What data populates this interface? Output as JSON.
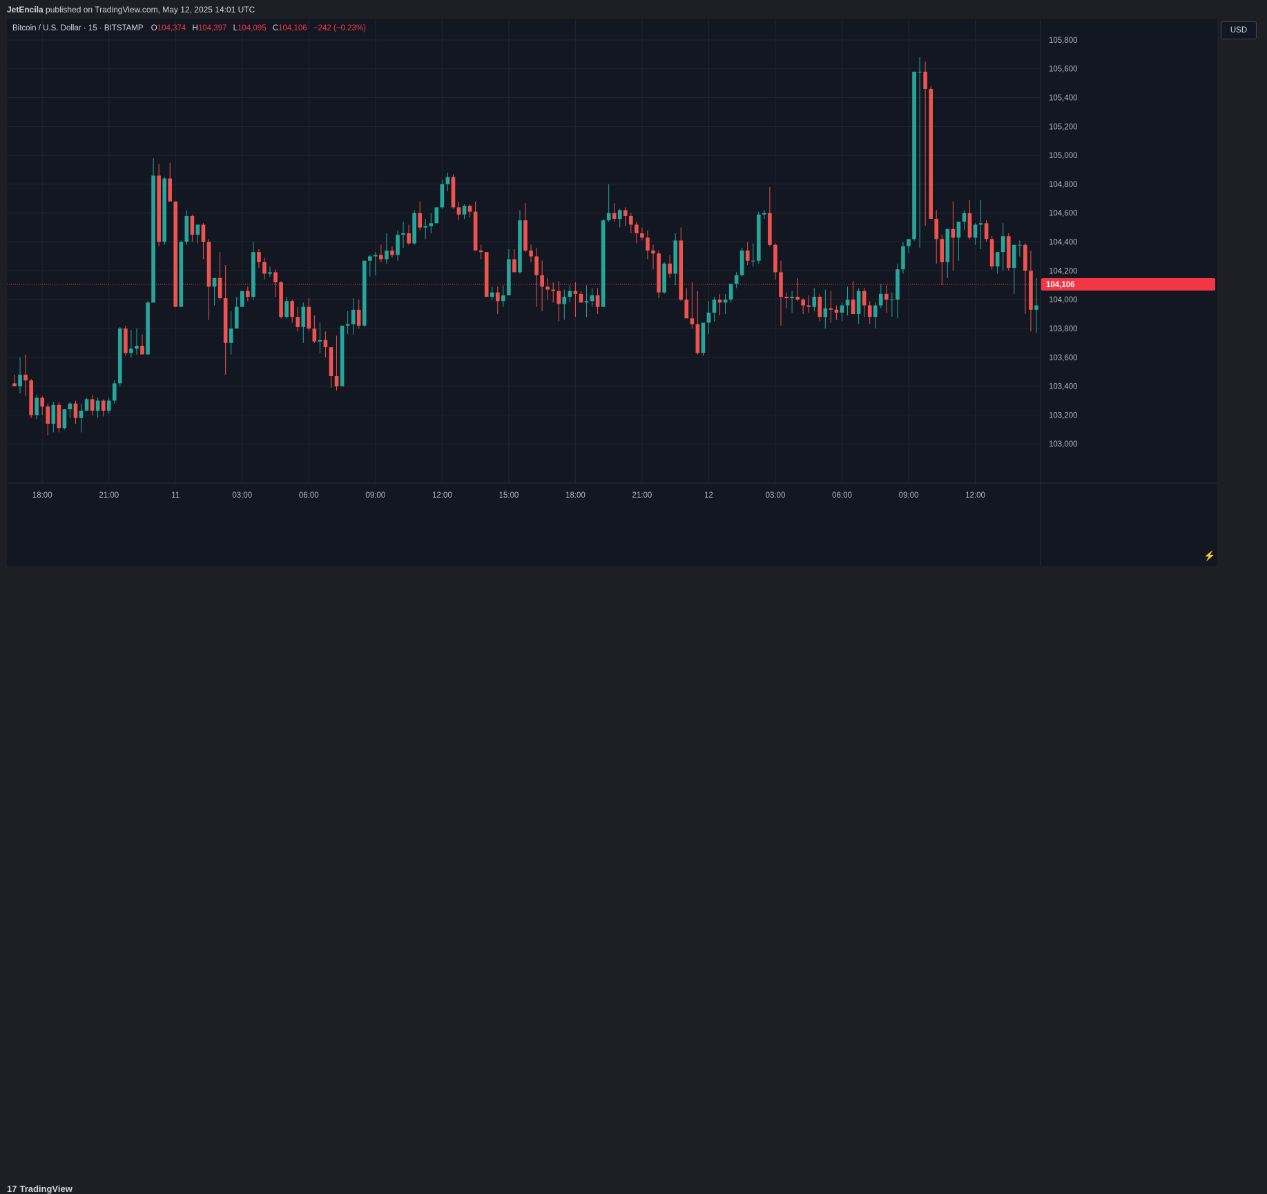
{
  "header": {
    "author": "JetEncila",
    "published_text": "published on TradingView.com, May 12, 2025 14:01 UTC"
  },
  "legend": {
    "symbol": "Bitcoin / U.S. Dollar · 15 · BITSTAMP",
    "o_key": "O",
    "o_val": "104,374",
    "h_key": "H",
    "h_val": "104,397",
    "l_key": "L",
    "l_val": "104,095",
    "c_key": "C",
    "c_val": "104,106",
    "change": "−242 (−0.23%)"
  },
  "currency_button": "USD",
  "footer": {
    "logo_mark": "17",
    "logo_text": "TradingView"
  },
  "colors": {
    "up": "#26a69a",
    "down": "#ef5350",
    "background": "#131722",
    "grid": "#1f2532",
    "price_tag": "#f23645"
  },
  "chart_data": {
    "type": "candlestick",
    "symbol": "BTCUSD",
    "exchange": "BITSTAMP",
    "interval": "15",
    "ylim": [
      102800,
      105900
    ],
    "y_ticks": [
      103000,
      103200,
      103400,
      103600,
      103800,
      104000,
      104200,
      104400,
      104600,
      104800,
      105000,
      105200,
      105400,
      105600,
      105800
    ],
    "y_tick_labels": [
      "103,000",
      "103,200",
      "103,400",
      "103,600",
      "103,800",
      "104,000",
      "104,200",
      "104,400",
      "104,600",
      "104,800",
      "105,000",
      "105,200",
      "105,400",
      "105,600",
      "105,800"
    ],
    "x_ticks": [
      {
        "label": "18:00",
        "bar": 5
      },
      {
        "label": "21:00",
        "bar": 17
      },
      {
        "label": "11",
        "bar": 29
      },
      {
        "label": "03:00",
        "bar": 41
      },
      {
        "label": "06:00",
        "bar": 53
      },
      {
        "label": "09:00",
        "bar": 65
      },
      {
        "label": "12:00",
        "bar": 77
      },
      {
        "label": "15:00",
        "bar": 89
      },
      {
        "label": "18:00",
        "bar": 101
      },
      {
        "label": "21:00",
        "bar": 113
      },
      {
        "label": "12",
        "bar": 125
      },
      {
        "label": "03:00",
        "bar": 137
      },
      {
        "label": "06:00",
        "bar": 149
      },
      {
        "label": "09:00",
        "bar": 161
      },
      {
        "label": "12:00",
        "bar": 173
      }
    ],
    "last_price": 104106,
    "last_price_label": "104,106",
    "grid": true,
    "candles": [
      [
        103420,
        103480,
        103400,
        103400
      ],
      [
        103400,
        103600,
        103350,
        103480
      ],
      [
        103480,
        103620,
        103330,
        103440
      ],
      [
        103440,
        103450,
        103180,
        103200
      ],
      [
        103200,
        103340,
        103170,
        103320
      ],
      [
        103320,
        103330,
        103200,
        103260
      ],
      [
        103260,
        103280,
        103060,
        103140
      ],
      [
        103140,
        103290,
        103080,
        103270
      ],
      [
        103270,
        103290,
        103080,
        103110
      ],
      [
        103110,
        103240,
        103100,
        103240
      ],
      [
        103240,
        103290,
        103180,
        103280
      ],
      [
        103280,
        103300,
        103140,
        103180
      ],
      [
        103180,
        103280,
        103080,
        103230
      ],
      [
        103230,
        103320,
        103230,
        103310
      ],
      [
        103310,
        103340,
        103200,
        103230
      ],
      [
        103230,
        103320,
        103180,
        103300
      ],
      [
        103300,
        103310,
        103190,
        103230
      ],
      [
        103230,
        103320,
        103210,
        103300
      ],
      [
        103300,
        103440,
        103280,
        103420
      ],
      [
        103420,
        103810,
        103400,
        103800
      ],
      [
        103800,
        103820,
        103610,
        103630
      ],
      [
        103630,
        103790,
        103600,
        103660
      ],
      [
        103660,
        103800,
        103620,
        103680
      ],
      [
        103680,
        103760,
        103620,
        103620
      ],
      [
        103620,
        103990,
        103620,
        103980
      ],
      [
        103980,
        104980,
        103980,
        104860
      ],
      [
        104860,
        104940,
        104370,
        104400
      ],
      [
        104400,
        104850,
        104380,
        104840
      ],
      [
        104840,
        104950,
        104680,
        104680
      ],
      [
        104680,
        104680,
        103950,
        103950
      ],
      [
        103950,
        104410,
        103950,
        104400
      ],
      [
        104400,
        104620,
        104380,
        104580
      ],
      [
        104580,
        104590,
        104400,
        104450
      ],
      [
        104450,
        104520,
        104390,
        104520
      ],
      [
        104520,
        104530,
        104280,
        104400
      ],
      [
        104400,
        104420,
        103860,
        104090
      ],
      [
        104090,
        104150,
        103960,
        104150
      ],
      [
        104150,
        104330,
        104000,
        104010
      ],
      [
        104010,
        104240,
        103480,
        103700
      ],
      [
        103700,
        103920,
        103620,
        103800
      ],
      [
        103800,
        104020,
        103800,
        103950
      ],
      [
        103950,
        104060,
        103950,
        104060
      ],
      [
        104060,
        104090,
        103990,
        104020
      ],
      [
        104020,
        104400,
        104000,
        104330
      ],
      [
        104330,
        104350,
        104220,
        104260
      ],
      [
        104260,
        104290,
        104140,
        104180
      ],
      [
        104180,
        104230,
        104160,
        104190
      ],
      [
        104190,
        104210,
        104020,
        104120
      ],
      [
        104120,
        104130,
        103870,
        103880
      ],
      [
        103880,
        104020,
        103870,
        103990
      ],
      [
        103990,
        104000,
        103840,
        103880
      ],
      [
        103880,
        103950,
        103780,
        103810
      ],
      [
        103810,
        103980,
        103700,
        103950
      ],
      [
        103950,
        104010,
        103780,
        103800
      ],
      [
        103800,
        103890,
        103700,
        103710
      ],
      [
        103710,
        103840,
        103630,
        103720
      ],
      [
        103720,
        103780,
        103600,
        103670
      ],
      [
        103670,
        103670,
        103390,
        103470
      ],
      [
        103470,
        103750,
        103370,
        103400
      ],
      [
        103400,
        103820,
        103400,
        103820
      ],
      [
        103820,
        103920,
        103760,
        103830
      ],
      [
        103830,
        104010,
        103760,
        103930
      ],
      [
        103930,
        104000,
        103800,
        103820
      ],
      [
        103820,
        104270,
        103810,
        104270
      ],
      [
        104270,
        104310,
        104160,
        104300
      ],
      [
        104300,
        104330,
        104170,
        104310
      ],
      [
        104310,
        104380,
        104260,
        104280
      ],
      [
        104280,
        104460,
        104250,
        104340
      ],
      [
        104340,
        104370,
        104290,
        104310
      ],
      [
        104310,
        104480,
        104270,
        104450
      ],
      [
        104450,
        104540,
        104360,
        104460
      ],
      [
        104460,
        104520,
        104380,
        104390
      ],
      [
        104390,
        104620,
        104380,
        104600
      ],
      [
        104600,
        104680,
        104480,
        104500
      ],
      [
        104500,
        104560,
        104420,
        104510
      ],
      [
        104510,
        104600,
        104460,
        104530
      ],
      [
        104530,
        104640,
        104530,
        104640
      ],
      [
        104640,
        104830,
        104630,
        104800
      ],
      [
        104800,
        104880,
        104750,
        104850
      ],
      [
        104850,
        104870,
        104630,
        104640
      ],
      [
        104640,
        104680,
        104550,
        104590
      ],
      [
        104590,
        104660,
        104560,
        104650
      ],
      [
        104650,
        104660,
        104570,
        104610
      ],
      [
        104610,
        104680,
        104340,
        104340
      ],
      [
        104340,
        104380,
        104280,
        104330
      ],
      [
        104330,
        104330,
        104020,
        104020
      ],
      [
        104020,
        104090,
        104000,
        104050
      ],
      [
        104050,
        104090,
        103900,
        103990
      ],
      [
        103990,
        104100,
        103950,
        104030
      ],
      [
        104030,
        104350,
        104030,
        104280
      ],
      [
        104280,
        104350,
        104240,
        104190
      ],
      [
        104190,
        104620,
        104180,
        104550
      ],
      [
        104550,
        104670,
        104330,
        104340
      ],
      [
        104340,
        104380,
        104260,
        104300
      ],
      [
        104300,
        104360,
        103950,
        104170
      ],
      [
        104170,
        104270,
        103920,
        104090
      ],
      [
        104090,
        104150,
        104000,
        104070
      ],
      [
        104070,
        104120,
        103980,
        104060
      ],
      [
        104060,
        104130,
        103850,
        103970
      ],
      [
        103970,
        104070,
        103860,
        104020
      ],
      [
        104020,
        104100,
        103980,
        104060
      ],
      [
        104060,
        104120,
        103880,
        104040
      ],
      [
        104040,
        104060,
        103980,
        103980
      ],
      [
        103980,
        104100,
        103880,
        103990
      ],
      [
        103990,
        104080,
        103950,
        104030
      ],
      [
        104030,
        104080,
        103900,
        103950
      ],
      [
        103950,
        104560,
        103950,
        104550
      ],
      [
        104550,
        104800,
        104540,
        104600
      ],
      [
        104600,
        104670,
        104540,
        104560
      ],
      [
        104560,
        104630,
        104500,
        104620
      ],
      [
        104620,
        104640,
        104510,
        104580
      ],
      [
        104580,
        104600,
        104460,
        104520
      ],
      [
        104520,
        104540,
        104390,
        104460
      ],
      [
        104460,
        104500,
        104410,
        104430
      ],
      [
        104430,
        104480,
        104280,
        104340
      ],
      [
        104340,
        104380,
        104210,
        104320
      ],
      [
        104320,
        104340,
        104010,
        104050
      ],
      [
        104050,
        104260,
        104040,
        104250
      ],
      [
        104250,
        104310,
        104150,
        104180
      ],
      [
        104180,
        104460,
        104100,
        104410
      ],
      [
        104410,
        104500,
        103990,
        104000
      ],
      [
        104000,
        104080,
        103880,
        103870
      ],
      [
        103870,
        104120,
        103800,
        103830
      ],
      [
        103830,
        104060,
        103620,
        103630
      ],
      [
        103630,
        103840,
        103610,
        103840
      ],
      [
        103840,
        103990,
        103760,
        103910
      ],
      [
        103910,
        104020,
        103850,
        104000
      ],
      [
        104000,
        104040,
        103890,
        103980
      ],
      [
        103980,
        104040,
        103900,
        104000
      ],
      [
        104000,
        104110,
        103980,
        104110
      ],
      [
        104110,
        104190,
        104080,
        104170
      ],
      [
        104170,
        104360,
        104160,
        104340
      ],
      [
        104340,
        104400,
        104240,
        104270
      ],
      [
        104270,
        104390,
        104230,
        104270
      ],
      [
        104270,
        104610,
        104250,
        104590
      ],
      [
        104590,
        104620,
        104560,
        104600
      ],
      [
        104600,
        104780,
        104370,
        104380
      ],
      [
        104380,
        104390,
        104140,
        104190
      ],
      [
        104190,
        104270,
        103820,
        104020
      ],
      [
        104020,
        104050,
        103940,
        104010
      ],
      [
        104010,
        104060,
        103910,
        104020
      ],
      [
        104020,
        104150,
        103990,
        104000
      ],
      [
        104000,
        104010,
        103900,
        103960
      ],
      [
        103960,
        104030,
        103910,
        103950
      ],
      [
        103950,
        104080,
        103920,
        104020
      ],
      [
        104020,
        104040,
        103850,
        103880
      ],
      [
        103880,
        104070,
        103800,
        103940
      ],
      [
        103940,
        104060,
        103840,
        103930
      ],
      [
        103930,
        103960,
        103860,
        103910
      ],
      [
        103910,
        103980,
        103850,
        103960
      ],
      [
        103960,
        104090,
        103890,
        104000
      ],
      [
        104000,
        104130,
        103900,
        103900
      ],
      [
        103900,
        104080,
        103830,
        104060
      ],
      [
        104060,
        104080,
        103880,
        103960
      ],
      [
        103960,
        103990,
        103830,
        103880
      ],
      [
        103880,
        103980,
        103800,
        103960
      ],
      [
        103960,
        104110,
        103940,
        104040
      ],
      [
        104040,
        104100,
        103910,
        104000
      ],
      [
        104000,
        104050,
        103880,
        104000
      ],
      [
        104000,
        104250,
        103870,
        104210
      ],
      [
        104210,
        104400,
        104180,
        104370
      ],
      [
        104370,
        104410,
        104320,
        104420
      ],
      [
        104420,
        105580,
        104410,
        105580
      ],
      [
        105580,
        105680,
        104360,
        105580
      ],
      [
        105580,
        105650,
        104510,
        105460
      ],
      [
        105460,
        105480,
        104560,
        104560
      ],
      [
        104560,
        104620,
        104250,
        104420
      ],
      [
        104420,
        104450,
        104100,
        104260
      ],
      [
        104260,
        104470,
        104150,
        104490
      ],
      [
        104490,
        104680,
        104200,
        104430
      ],
      [
        104430,
        104540,
        104270,
        104540
      ],
      [
        104540,
        104620,
        104480,
        104600
      ],
      [
        104600,
        104690,
        104420,
        104430
      ],
      [
        104430,
        104530,
        104380,
        104520
      ],
      [
        104520,
        104690,
        104350,
        104530
      ],
      [
        104530,
        104550,
        104400,
        104420
      ],
      [
        104420,
        104440,
        104210,
        104230
      ],
      [
        104230,
        104330,
        104180,
        104330
      ],
      [
        104330,
        104530,
        104200,
        104440
      ],
      [
        104440,
        104460,
        104200,
        104220
      ],
      [
        104220,
        104240,
        104040,
        104380
      ],
      [
        104380,
        104410,
        104300,
        104380
      ],
      [
        104380,
        104390,
        103900,
        104200
      ],
      [
        104200,
        104340,
        103780,
        103930
      ],
      [
        103930,
        104150,
        103770,
        103960
      ]
    ]
  }
}
